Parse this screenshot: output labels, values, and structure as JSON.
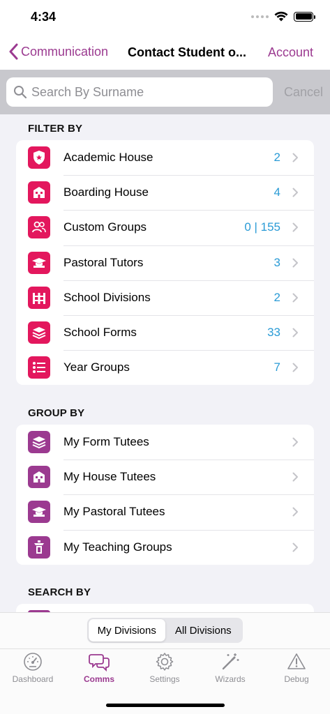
{
  "status": {
    "time": "4:34"
  },
  "nav": {
    "back_label": "Communication",
    "title": "Contact Student o...",
    "account_label": "Account"
  },
  "search": {
    "placeholder": "Search By Surname",
    "cancel_label": "Cancel"
  },
  "filter_by": {
    "header": "FILTER BY",
    "items": [
      {
        "label": "Academic House",
        "count": "2",
        "icon": "shield-star-icon"
      },
      {
        "label": "Boarding House",
        "count": "4",
        "icon": "building-icon"
      },
      {
        "label": "Custom Groups",
        "count": "0 | 155",
        "icon": "people-icon"
      },
      {
        "label": "Pastoral Tutors",
        "count": "3",
        "icon": "graduation-cap-icon"
      },
      {
        "label": "School Divisions",
        "count": "2",
        "icon": "fence-icon"
      },
      {
        "label": "School Forms",
        "count": "33",
        "icon": "layers-icon"
      },
      {
        "label": "Year Groups",
        "count": "7",
        "icon": "list-icon"
      }
    ]
  },
  "group_by": {
    "header": "GROUP BY",
    "items": [
      {
        "label": "My Form Tutees",
        "icon": "layers-icon"
      },
      {
        "label": "My House Tutees",
        "icon": "building-icon"
      },
      {
        "label": "My Pastoral Tutees",
        "icon": "graduation-cap-icon"
      },
      {
        "label": "My Teaching Groups",
        "icon": "lectern-icon"
      }
    ]
  },
  "search_by": {
    "header": "SEARCH BY"
  },
  "segment": {
    "options": [
      "My Divisions",
      "All Divisions"
    ],
    "selected": "My Divisions"
  },
  "tabs": [
    {
      "label": "Dashboard",
      "icon": "gauge-icon"
    },
    {
      "label": "Comms",
      "icon": "chat-bubbles-icon",
      "active": true
    },
    {
      "label": "Settings",
      "icon": "gear-icon"
    },
    {
      "label": "Wizards",
      "icon": "magic-wand-icon"
    },
    {
      "label": "Debug",
      "icon": "warning-icon"
    }
  ],
  "colors": {
    "accent": "#9b3a90",
    "filter_icon": "#e3175d",
    "count": "#2a9bd6"
  }
}
